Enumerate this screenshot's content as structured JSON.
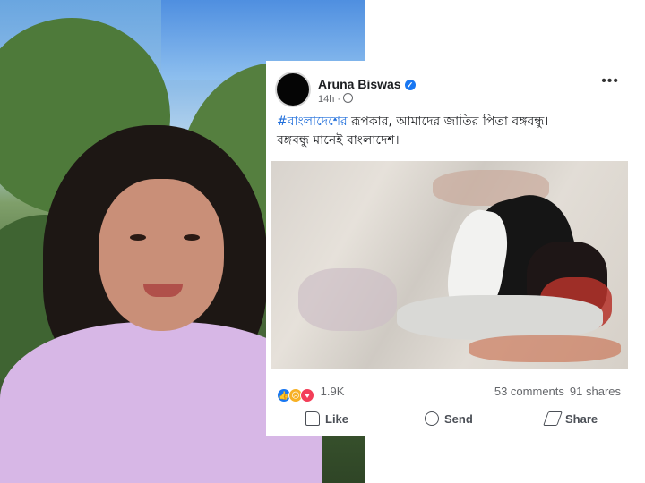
{
  "post": {
    "author": "Aruna Biswas",
    "time": "14h ·",
    "text_hashtag": "#বাংলাদেশের",
    "text_line1_rest": " রূপকার, আমাদের জাতির  পিতা বঙ্গবন্ধু।",
    "text_line2": "বঙ্গবন্ধু মানেই বাংলাদেশ।",
    "reaction_count": "1.9K",
    "comments": "53 comments",
    "shares": "91 shares",
    "actions": {
      "like": "Like",
      "send": "Send",
      "share": "Share"
    }
  },
  "icons": [
    "verified-badge-icon",
    "globe-icon",
    "more-options-icon",
    "like-reaction-icon",
    "sad-reaction-icon",
    "love-reaction-icon",
    "like-icon",
    "send-icon",
    "share-icon"
  ],
  "colors": {
    "accent": "#1877f2",
    "hashtag": "#216fdb",
    "text": "#1c1e21",
    "muted": "#65676b"
  }
}
